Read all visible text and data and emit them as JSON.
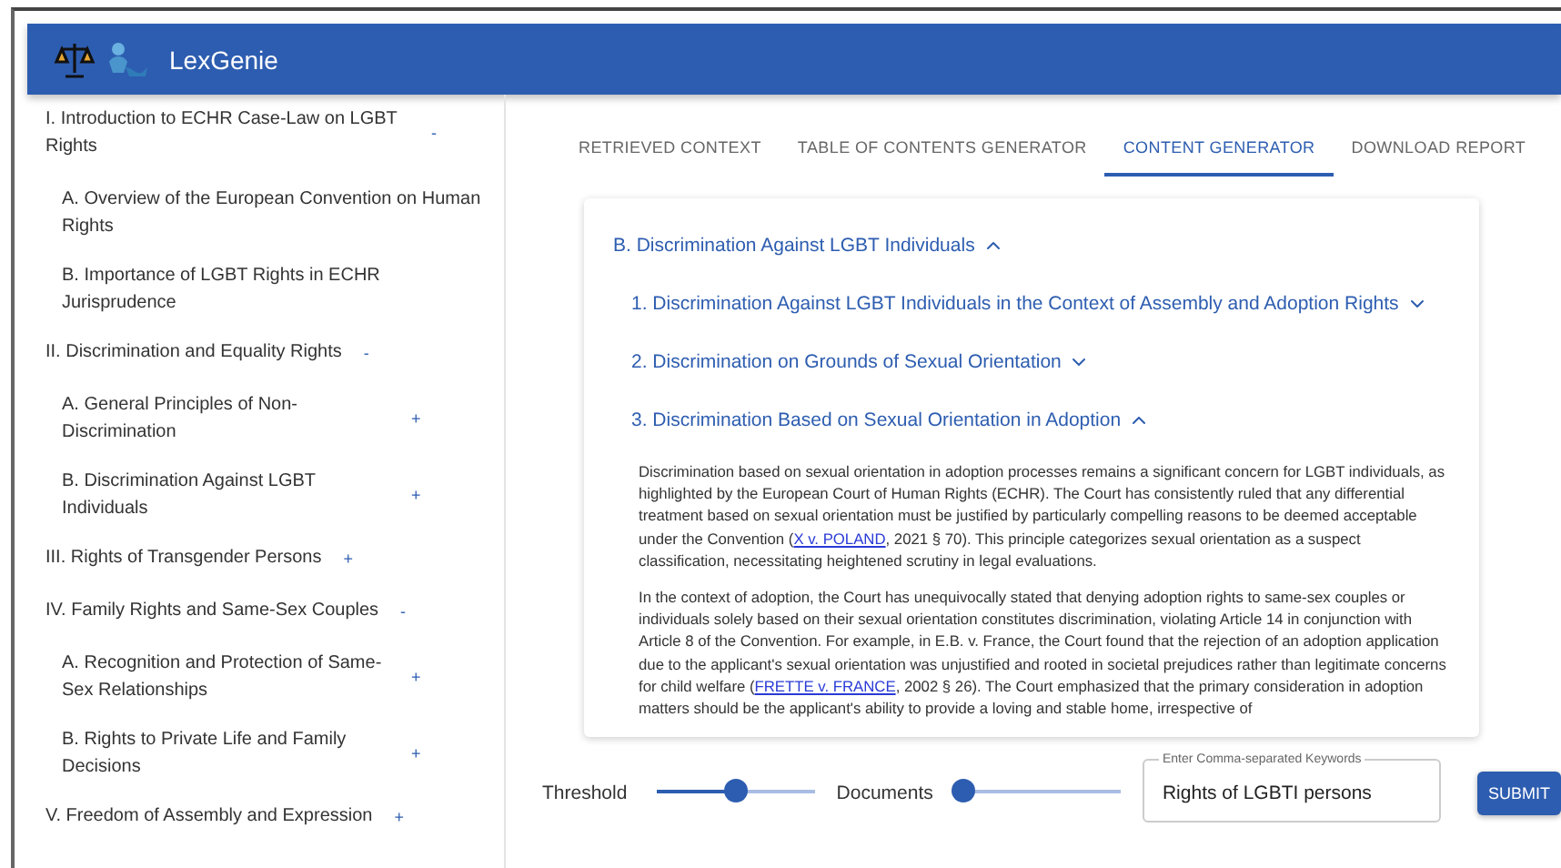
{
  "app": {
    "title": "LexGenie"
  },
  "sidebar": {
    "items": [
      {
        "title": "I. Introduction to ECHR Case-Law on LGBT Rights",
        "toggle": "-",
        "children": [
          {
            "title": "A. Overview of the European Convention on Human Rights"
          },
          {
            "title": "B. Importance of LGBT Rights in ECHR Jurisprudence"
          }
        ]
      },
      {
        "title": "II. Discrimination and Equality Rights",
        "toggle": "-",
        "children": [
          {
            "title": "A. General Principles of Non-Discrimination",
            "toggle": "+"
          },
          {
            "title": "B. Discrimination Against LGBT Individuals",
            "toggle": "+"
          }
        ]
      },
      {
        "title": "III. Rights of Transgender Persons",
        "toggle": "+"
      },
      {
        "title": "IV. Family Rights and Same-Sex Couples",
        "toggle": "-",
        "children": [
          {
            "title": "A. Recognition and Protection of Same-Sex Relationships",
            "toggle": "+"
          },
          {
            "title": "B. Rights to Private Life and Family Decisions",
            "toggle": "+"
          }
        ]
      },
      {
        "title": "V. Freedom of Assembly and Expression",
        "toggle": "+"
      }
    ]
  },
  "tabs": [
    {
      "label": "RETRIEVED CONTEXT",
      "selected": false
    },
    {
      "label": "TABLE OF CONTENTS GENERATOR",
      "selected": false
    },
    {
      "label": "CONTENT GENERATOR",
      "selected": true
    },
    {
      "label": "DOWNLOAD REPORT",
      "selected": false
    }
  ],
  "content": {
    "title": "B. Discrimination Against LGBT Individuals",
    "expanded": true,
    "sections": [
      {
        "title": "1. Discrimination Against LGBT Individuals in the Context of Assembly and Adoption Rights",
        "expanded": false
      },
      {
        "title": "2. Discrimination on Grounds of Sexual Orientation",
        "expanded": false
      },
      {
        "title": "3. Discrimination Based on Sexual Orientation in Adoption",
        "expanded": true,
        "paragraphs": [
          [
            {
              "kind": "text",
              "text": "Discrimination based on sexual orientation in adoption processes remains a significant concern for LGBT individuals, as highlighted by the European Court of Human Rights (ECHR). The Court has consistently ruled that any differential treatment based on sexual orientation must be justified by particularly compelling reasons to be deemed acceptable under the Convention ("
            },
            {
              "kind": "link",
              "text": "X v. POLAND"
            },
            {
              "kind": "text",
              "text": ", 2021 § 70). This principle categorizes sexual orientation as a suspect classification, necessitating heightened scrutiny in legal evaluations."
            }
          ],
          [
            {
              "kind": "text",
              "text": "In the context of adoption, the Court has unequivocally stated that denying adoption rights to same-sex couples or individuals solely based on their sexual orientation constitutes discrimination, violating Article 14 in conjunction with Article 8 of the Convention. For example, in E.B. v. France, the Court found that the rejection of an adoption application due to the applicant's sexual orientation was unjustified and rooted in societal prejudices rather than legitimate concerns for child welfare ("
            },
            {
              "kind": "link",
              "text": "FRETTE v. FRANCE"
            },
            {
              "kind": "text",
              "text": ", 2002 § 26). The Court emphasized that the primary consideration in adoption matters should be the applicant's ability to provide a loving and stable home, irrespective of"
            }
          ]
        ]
      }
    ]
  },
  "controls": {
    "sliders": [
      {
        "label": "Threshold",
        "level": 0.5
      },
      {
        "label": "Documents",
        "level": 0
      }
    ],
    "keywords": {
      "label": "Enter Comma-separated Keywords",
      "value": "Rights of LGBTI persons"
    },
    "submit": "SUBMIT"
  }
}
